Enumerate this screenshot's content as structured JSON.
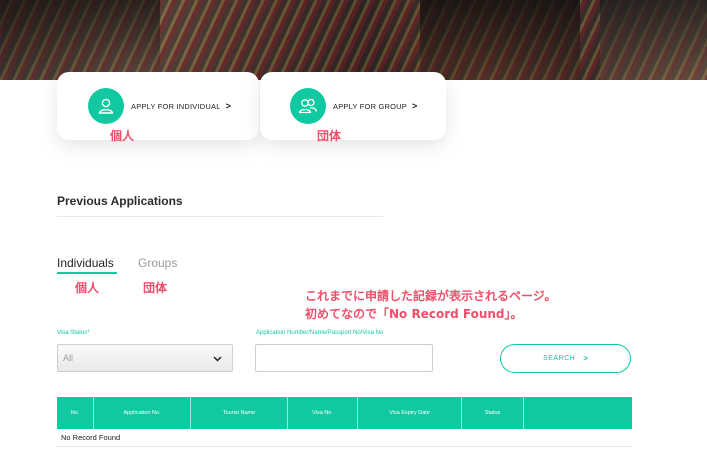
{
  "cards": {
    "individual": {
      "label": "APPLY FOR INDIVIDUAL",
      "chevron": ">",
      "icon": "person-icon"
    },
    "group": {
      "label": "APPLY FOR GROUP",
      "chevron": ">",
      "icon": "group-icon"
    }
  },
  "annotations": {
    "individual_jp": "個人",
    "group_jp": "団体",
    "tab_individual_jp": "個人",
    "tab_group_jp": "団体",
    "note_line1": "これまでに申請した記録が表示されるページ。",
    "note_line2": "初めてなので「No Record Found」。"
  },
  "previous": {
    "title": "Previous Applications"
  },
  "tabs": {
    "individuals": "Individuals",
    "groups": "Groups"
  },
  "filters": {
    "visa_status_label": "Visa Status*",
    "visa_status_value": "All",
    "app_no_label": "Application Number/Name/Passport No/Visa No",
    "app_no_value": ""
  },
  "search": {
    "label": "SEARCH",
    "chevron": ">"
  },
  "table": {
    "columns": [
      "No.",
      "Application No.",
      "Tourist Name",
      "Visa No.",
      "Visa Expiry Date",
      "Status",
      ""
    ],
    "empty_text": "No Record Found"
  },
  "colors": {
    "accent": "#10c9a0",
    "annotation": "#ef4f6a"
  }
}
